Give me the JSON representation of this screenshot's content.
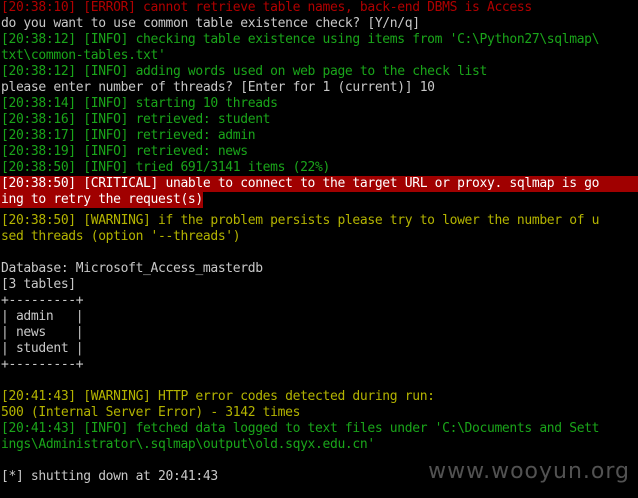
{
  "colors": {
    "background": "#000000",
    "error": "#b00000",
    "info": "#1aa51a",
    "warning": "#b3b300",
    "plain": "#c8c8c8",
    "critical_bg": "#a00000",
    "critical_fg": "#ffffff"
  },
  "console": {
    "lines": [
      {
        "kind": "error",
        "text": "[20:38:10] [ERROR] cannot retrieve table names, back-end DBMS is Access"
      },
      {
        "kind": "plain",
        "text": "do you want to use common table existence check? [Y/n/q]"
      },
      {
        "kind": "info",
        "text": "[20:38:12] [INFO] checking table existence using items from 'C:\\Python27\\sqlmap\\"
      },
      {
        "kind": "info",
        "text": "txt\\common-tables.txt'"
      },
      {
        "kind": "info",
        "text": "[20:38:12] [INFO] adding words used on web page to the check list"
      },
      {
        "kind": "plain",
        "text": "please enter number of threads? [Enter for 1 (current)] 10"
      },
      {
        "kind": "info",
        "text": "[20:38:14] [INFO] starting 10 threads"
      },
      {
        "kind": "info",
        "text": "[20:38:16] [INFO] retrieved: student"
      },
      {
        "kind": "info",
        "text": "[20:38:17] [INFO] retrieved: admin"
      },
      {
        "kind": "info",
        "text": "[20:38:19] [INFO] retrieved: news"
      },
      {
        "kind": "info",
        "text": "[20:38:50] [INFO] tried 691/3141 items (22%)"
      },
      {
        "kind": "crit",
        "text": "[20:38:50] [CRITICAL] unable to connect to the target URL or proxy. sqlmap is go"
      },
      {
        "kind": "crit",
        "text": "ing to retry the request(s)"
      },
      {
        "kind": "warn",
        "text": "[20:38:50] [WARNING] if the problem persists please try to lower the number of u"
      },
      {
        "kind": "warn",
        "text": "sed threads (option '--threads')"
      },
      {
        "kind": "plain",
        "text": ""
      },
      {
        "kind": "plain",
        "text": "Database: Microsoft_Access_masterdb"
      },
      {
        "kind": "plain",
        "text": "[3 tables]"
      },
      {
        "kind": "plain",
        "text": "+---------+"
      },
      {
        "kind": "plain",
        "text": "| admin   |"
      },
      {
        "kind": "plain",
        "text": "| news    |"
      },
      {
        "kind": "plain",
        "text": "| student |"
      },
      {
        "kind": "plain",
        "text": "+---------+"
      },
      {
        "kind": "plain",
        "text": ""
      },
      {
        "kind": "warn",
        "text": "[20:41:43] [WARNING] HTTP error codes detected during run:"
      },
      {
        "kind": "warn",
        "text": "500 (Internal Server Error) - 3142 times"
      },
      {
        "kind": "info",
        "text": "[20:41:43] [INFO] fetched data logged to text files under 'C:\\Documents and Sett"
      },
      {
        "kind": "info",
        "text": "ings\\Administrator\\.sqlmap\\output\\old.sqyx.edu.cn'"
      },
      {
        "kind": "plain",
        "text": ""
      },
      {
        "kind": "plain",
        "text": "[*] shutting down at 20:41:43"
      }
    ]
  },
  "watermark": "www.wooyun.org"
}
